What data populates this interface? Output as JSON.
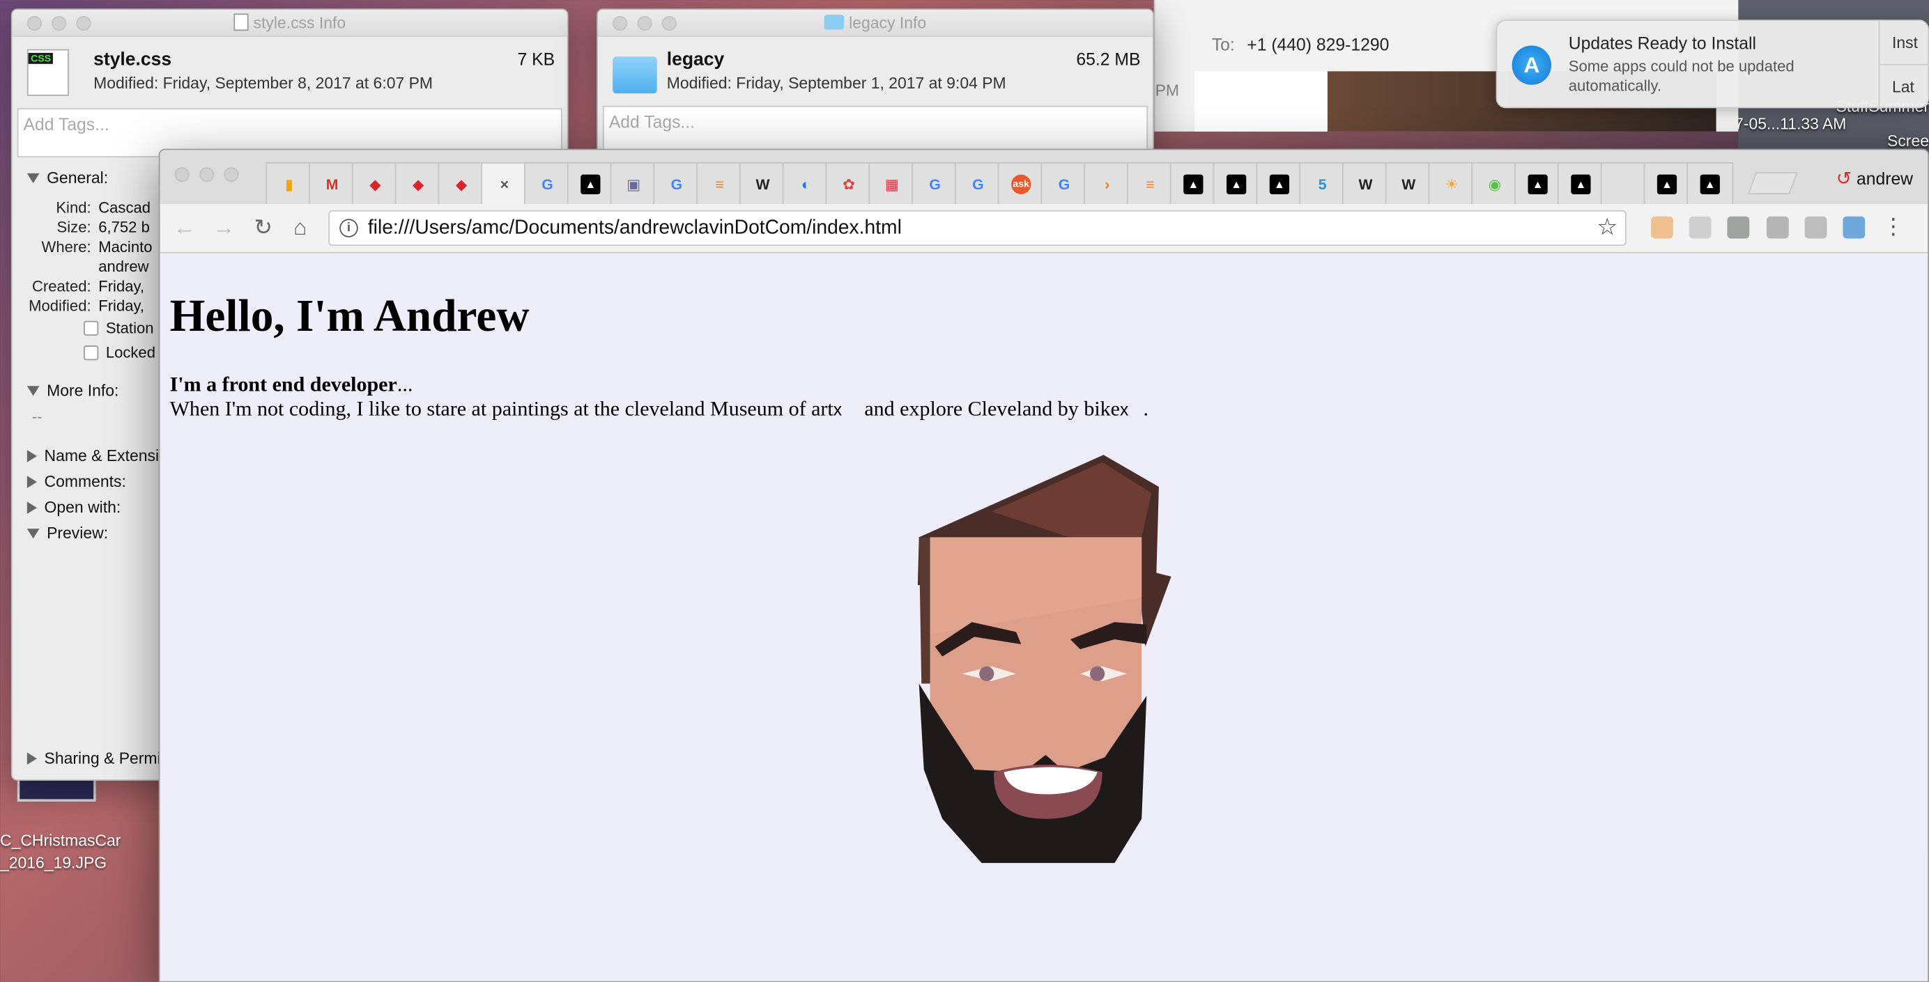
{
  "desktop": {
    "file_label_1": "C_CHristmasCar",
    "file_label_2": "_2016_19.JPG",
    "right_label_1": "StuffSummer",
    "right_label_2": "Scree",
    "right_label_3": "7-05...11.33 AM"
  },
  "style_info": {
    "window_title": "style.css Info",
    "filename": "style.css",
    "size": "7 KB",
    "modified": "Modified: Friday, September 8, 2017 at 6:07 PM",
    "tags_placeholder": "Add Tags...",
    "general_label": "General:",
    "rows": [
      {
        "k": "Kind:",
        "v": "Cascad"
      },
      {
        "k": "Size:",
        "v": "6,752 b"
      },
      {
        "k": "Where:",
        "v": "Macinto"
      },
      {
        "k": "",
        "v": "andrew"
      },
      {
        "k": "Created:",
        "v": "Friday,"
      },
      {
        "k": "Modified:",
        "v": "Friday,"
      }
    ],
    "stationery": "Station",
    "locked": "Locked",
    "more_info": "More Info:",
    "more_info_value": "--",
    "name_ext": "Name & Extensio",
    "comments": "Comments:",
    "open_with": "Open with:",
    "preview": "Preview:",
    "sharing": "Sharing & Permi"
  },
  "legacy_info": {
    "window_title": "legacy Info",
    "filename": "legacy",
    "size": "65.2 MB",
    "modified": "Modified: Friday, September 1, 2017 at 9:04 PM",
    "tags_placeholder": "Add Tags..."
  },
  "mail": {
    "to_label": "To:",
    "to_value": "+1 (440) 829-1290",
    "pm": "PM"
  },
  "notification": {
    "title": "Updates Ready to Install",
    "body": "Some apps could not be updated automatically.",
    "btn_install": "Inst",
    "btn_later": "Lat"
  },
  "chrome": {
    "profile": "andrew",
    "close_glyph": "×",
    "url": "file:///Users/amc/Documents/andrewclavinDotCom/index.html",
    "tabs": [
      {
        "g": "▮",
        "c": "#f4a400"
      },
      {
        "g": "M",
        "c": "#d93025"
      },
      {
        "g": "◆",
        "c": "#d8262c"
      },
      {
        "g": "◆",
        "c": "#d8262c"
      },
      {
        "g": "◆",
        "c": "#d8262c"
      },
      {
        "g": "×",
        "c": "#555"
      },
      {
        "g": "G",
        "c": "#4285f4"
      },
      {
        "g": "▲",
        "c": "#000"
      },
      {
        "g": "▣",
        "c": "#6a6a9a"
      },
      {
        "g": "G",
        "c": "#4285f4"
      },
      {
        "g": "≡",
        "c": "#f48024"
      },
      {
        "g": "W",
        "c": "#222"
      },
      {
        "g": "◐",
        "c": "#1a73e8"
      },
      {
        "g": "✿",
        "c": "#d44"
      },
      {
        "g": "▦",
        "c": "#e34"
      },
      {
        "g": "G",
        "c": "#4285f4"
      },
      {
        "g": "G",
        "c": "#4285f4"
      },
      {
        "g": "ask",
        "c": "#e8582b"
      },
      {
        "g": "G",
        "c": "#4285f4"
      },
      {
        "g": "›",
        "c": "#f57c00"
      },
      {
        "g": "≡",
        "c": "#f48024"
      },
      {
        "g": "▲",
        "c": "#000"
      },
      {
        "g": "▲",
        "c": "#000"
      },
      {
        "g": "▲",
        "c": "#000"
      },
      {
        "g": "5",
        "c": "#2b8fd6"
      },
      {
        "g": "W",
        "c": "#222"
      },
      {
        "g": "W",
        "c": "#222"
      },
      {
        "g": "☀",
        "c": "#f5a623"
      },
      {
        "g": "◉",
        "c": "#54c242"
      },
      {
        "g": "▲",
        "c": "#000"
      },
      {
        "g": "▲",
        "c": "#000"
      },
      {
        "g": "",
        "c": "#999"
      },
      {
        "g": "▲",
        "c": "#000"
      },
      {
        "g": "▲",
        "c": "#000"
      }
    ]
  },
  "page": {
    "heading": "Hello, I'm Andrew",
    "lead_bold": "I'm a front end developer",
    "lead_ellipsis": "...",
    "body_1": "When I'm not coding, I like to stare at paintings at the cleveland Museum of art",
    "x1": "x",
    "body_2": " and explore Cleveland by bike",
    "x2": "x",
    "body_3": ".",
    "face_label": "avatar illustration"
  },
  "colors": {
    "page_bg": "#eeedfa",
    "skin": "#dd9f8a",
    "beard": "#1e1a1a",
    "mouth": "#8a4a52"
  }
}
